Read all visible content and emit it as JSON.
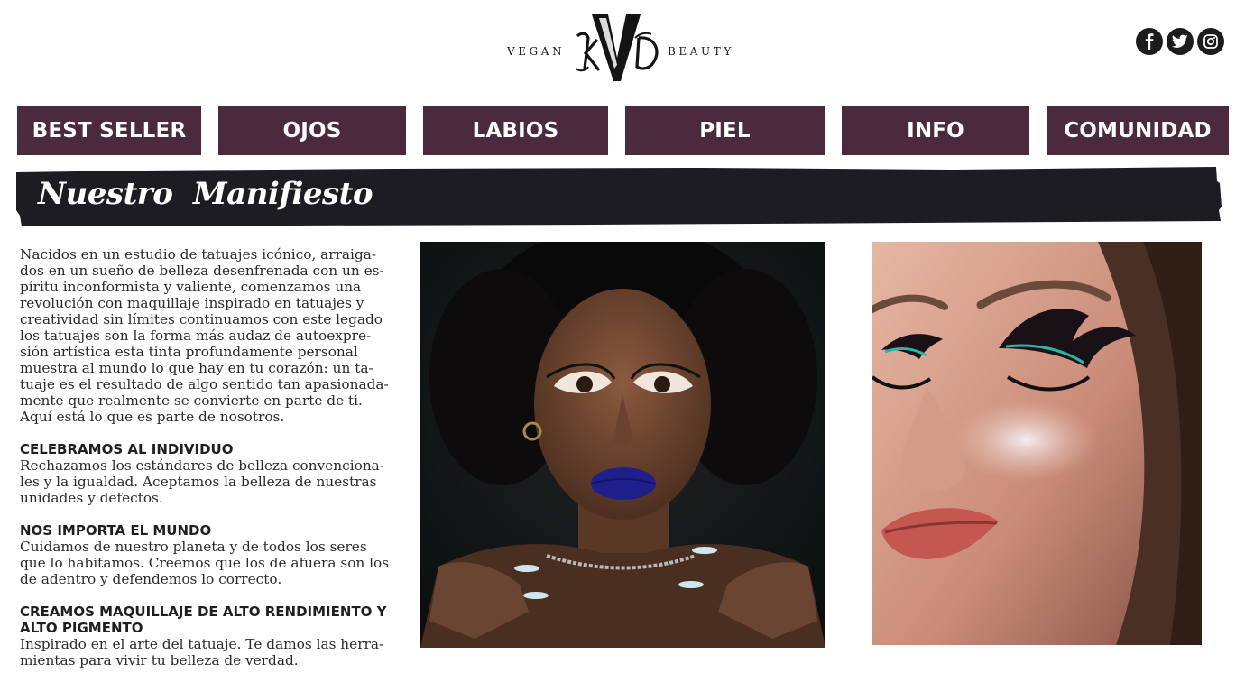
{
  "header": {
    "logo_left": "VEGAN",
    "logo_right": "BEAUTY",
    "logo_monogram": "KVD",
    "social": [
      {
        "name": "facebook-icon",
        "glyph": "f"
      },
      {
        "name": "twitter-icon",
        "glyph": "t"
      },
      {
        "name": "instagram-icon",
        "glyph": "ig"
      }
    ]
  },
  "nav": {
    "items": [
      "BEST SELLER",
      "OJOS",
      "LABIOS",
      "PIEL",
      "INFO",
      "COMUNIDAD"
    ]
  },
  "banner": {
    "title": "Nuestro  Manifiesto"
  },
  "content": {
    "intro": [
      "Nacidos en un estudio de tatuajes icónico, arraiga-",
      "dos en un sueño de belleza desenfrenada con un es-",
      "píritu inconformista y valiente, comenzamos una",
      "revolución con maquillaje inspirado en tatuajes y",
      "creatividad sin límites continuamos con este legado",
      "los tatuajes son la forma más audaz de autoexpre-",
      "sión artística esta tinta profundamente personal",
      "muestra al mundo lo que hay en tu corazón: un ta-",
      "tuaje es el resultado de algo sentido tan apasionada-",
      "mente que realmente se convierte en parte de ti.",
      "Aquí está lo que es parte de nosotros."
    ],
    "sections": [
      {
        "heading": [
          "CELEBRAMOS AL INDIVIDUO"
        ],
        "body": [
          "Rechazamos los estándares de belleza convenciona-",
          "les y la igualdad. Aceptamos la belleza de nuestras",
          "unidades y defectos."
        ]
      },
      {
        "heading": [
          "NOS IMPORTA EL MUNDO"
        ],
        "body": [
          "Cuidamos de nuestro planeta y de todos los seres",
          "que lo habitamos. Creemos que los de afuera son los",
          "de adentro y defendemos lo correcto."
        ]
      },
      {
        "heading": [
          "CREAMOS MAQUILLAJE DE ALTO RENDIMIENTO Y",
          "ALTO PIGMENTO"
        ],
        "body": [
          "Inspirado en el arte del tatuaje. Te damos las herra-",
          "mientas para vivir tu belleza de verdad."
        ]
      }
    ]
  },
  "colors": {
    "nav_bg": "#4a2a3c",
    "banner_bg": "#1c1c22",
    "text": "#2b2b2b"
  }
}
